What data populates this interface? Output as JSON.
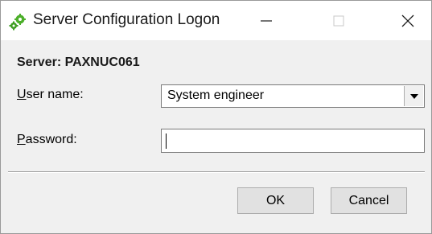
{
  "window": {
    "title": "Server Configuration Logon",
    "icon": "green-gear-icon",
    "controls": {
      "minimize": "minimize-icon",
      "maximize": "maximize-icon",
      "close": "close-icon"
    }
  },
  "server": {
    "label": "Server: PAXNUC061"
  },
  "user": {
    "label_accel": "U",
    "label_rest": "ser name:",
    "selected": "System engineer"
  },
  "password": {
    "label_accel": "P",
    "label_rest": "assword:",
    "value": ""
  },
  "buttons": {
    "ok": "OK",
    "cancel": "Cancel"
  },
  "colors": {
    "accent_icon": "#4caf2a",
    "window_bg": "#f0f0f0",
    "button_bg": "#e1e1e1"
  }
}
